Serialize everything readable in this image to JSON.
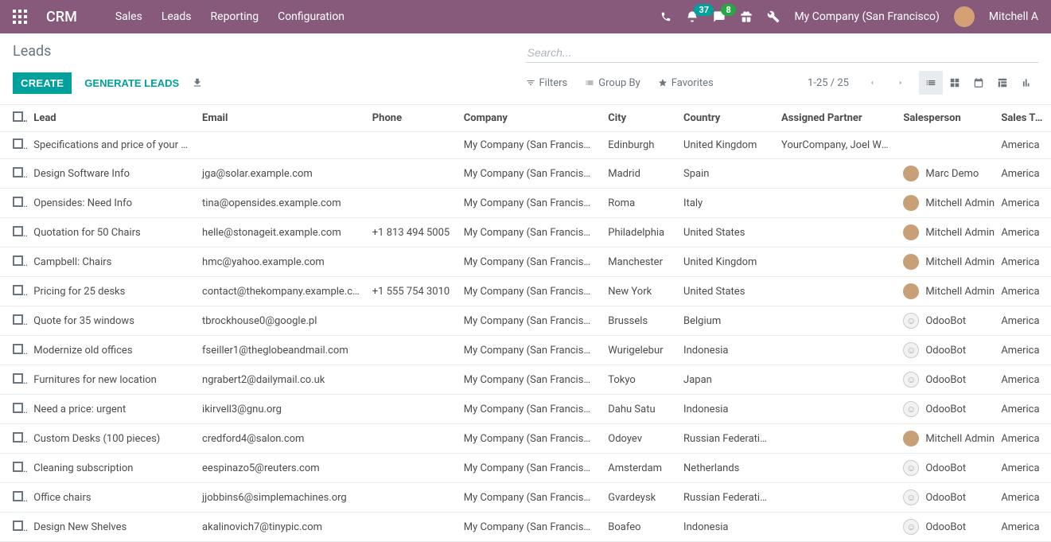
{
  "header": {
    "brand": "CRM",
    "menu": [
      "Sales",
      "Leads",
      "Reporting",
      "Configuration"
    ],
    "activity_badge": "37",
    "messages_badge": "8",
    "company": "My Company (San Francisco)",
    "username": "Mitchell A"
  },
  "breadcrumb": "Leads",
  "search": {
    "placeholder": "Search..."
  },
  "buttons": {
    "create": "Create",
    "generate": "Generate Leads"
  },
  "tools": {
    "filters": "Filters",
    "groupby": "Group By",
    "favorites": "Favorites"
  },
  "pager": "1-25 / 25",
  "columns": [
    "Lead",
    "Email",
    "Phone",
    "Company",
    "City",
    "Country",
    "Assigned Partner",
    "Salesperson",
    "Sales Team"
  ],
  "rows": [
    {
      "lead": "Specifications and price of your p...",
      "email": "",
      "phone": "",
      "company": "My Company (San Francisco)",
      "city": "Edinburgh",
      "country": "United Kingdom",
      "partner": "YourCompany, Joel Willis",
      "sp": "",
      "sp_type": "none",
      "team": "America"
    },
    {
      "lead": "Design Software Info",
      "email": "jga@solar.example.com",
      "phone": "",
      "company": "My Company (San Francisco)",
      "city": "Madrid",
      "country": "Spain",
      "partner": "",
      "sp": "Marc Demo",
      "sp_type": "user",
      "team": "America"
    },
    {
      "lead": "Opensides: Need Info",
      "email": "tina@opensides.example.com",
      "phone": "",
      "company": "My Company (San Francisco)",
      "city": "Roma",
      "country": "Italy",
      "partner": "",
      "sp": "Mitchell Admin",
      "sp_type": "user",
      "team": "America"
    },
    {
      "lead": "Quotation for 50 Chairs",
      "email": "helle@stonageit.example.com",
      "phone": "+1 813 494 5005",
      "company": "My Company (San Francisco)",
      "city": "Philadelphia",
      "country": "United States",
      "partner": "",
      "sp": "Mitchell Admin",
      "sp_type": "user",
      "team": "America"
    },
    {
      "lead": "Campbell: Chairs",
      "email": "hmc@yahoo.example.com",
      "phone": "",
      "company": "My Company (San Francisco)",
      "city": "Manchester",
      "country": "United Kingdom",
      "partner": "",
      "sp": "Mitchell Admin",
      "sp_type": "user",
      "team": "America"
    },
    {
      "lead": "Pricing for 25 desks",
      "email": "contact@thekompany.example.c...",
      "phone": "+1 555 754 3010",
      "company": "My Company (San Francisco)",
      "city": "New York",
      "country": "United States",
      "partner": "",
      "sp": "Mitchell Admin",
      "sp_type": "user",
      "team": "America"
    },
    {
      "lead": "Quote for 35 windows",
      "email": "tbrockhouse0@google.pl",
      "phone": "",
      "company": "My Company (San Francisco)",
      "city": "Brussels",
      "country": "Belgium",
      "partner": "",
      "sp": "OdooBot",
      "sp_type": "bot",
      "team": "America"
    },
    {
      "lead": "Modernize old offices",
      "email": "fseiller1@theglobeandmail.com",
      "phone": "",
      "company": "My Company (San Francisco)",
      "city": "Wurigelebur",
      "country": "Indonesia",
      "partner": "",
      "sp": "OdooBot",
      "sp_type": "bot",
      "team": "America"
    },
    {
      "lead": "Furnitures for new location",
      "email": "ngrabert2@dailymail.co.uk",
      "phone": "",
      "company": "My Company (San Francisco)",
      "city": "Tokyo",
      "country": "Japan",
      "partner": "",
      "sp": "OdooBot",
      "sp_type": "bot",
      "team": "America"
    },
    {
      "lead": "Need a price: urgent",
      "email": "ikirvell3@gnu.org",
      "phone": "",
      "company": "My Company (San Francisco)",
      "city": "Dahu Satu",
      "country": "Indonesia",
      "partner": "",
      "sp": "OdooBot",
      "sp_type": "bot",
      "team": "America"
    },
    {
      "lead": "Custom Desks (100 pieces)",
      "email": "credford4@salon.com",
      "phone": "",
      "company": "My Company (San Francisco)",
      "city": "Odoyev",
      "country": "Russian Federation",
      "partner": "",
      "sp": "Mitchell Admin",
      "sp_type": "user",
      "team": "America"
    },
    {
      "lead": "Cleaning subscription",
      "email": "eespinazo5@reuters.com",
      "phone": "",
      "company": "My Company (San Francisco)",
      "city": "Amsterdam",
      "country": "Netherlands",
      "partner": "",
      "sp": "OdooBot",
      "sp_type": "bot",
      "team": "America"
    },
    {
      "lead": "Office chairs",
      "email": "jjobbins6@simplemachines.org",
      "phone": "",
      "company": "My Company (San Francisco)",
      "city": "Gvardeysk",
      "country": "Russian Federation",
      "partner": "",
      "sp": "OdooBot",
      "sp_type": "bot",
      "team": "America"
    },
    {
      "lead": "Design New Shelves",
      "email": "akalinovich7@tinypic.com",
      "phone": "",
      "company": "My Company (San Francisco)",
      "city": "Boafeo",
      "country": "Indonesia",
      "partner": "",
      "sp": "OdooBot",
      "sp_type": "bot",
      "team": "America"
    }
  ]
}
